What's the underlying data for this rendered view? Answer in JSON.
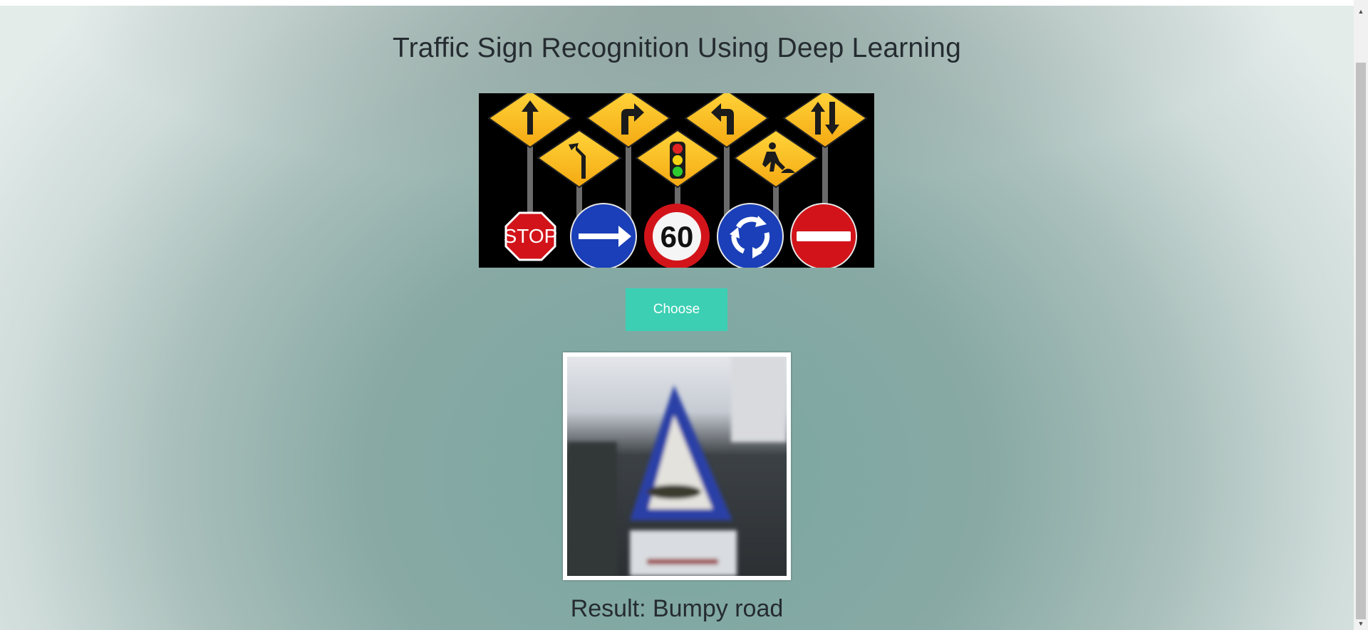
{
  "page": {
    "title": "Traffic Sign Recognition Using Deep Learning",
    "choose_label": "Choose",
    "result_text": "Result: Bumpy road"
  },
  "banner": {
    "icons": [
      "arrow-up-sign-icon",
      "turn-right-sign-icon",
      "turn-left-sign-icon",
      "two-way-traffic-sign-icon",
      "merge-left-sign-icon",
      "traffic-light-sign-icon",
      "road-work-sign-icon",
      "stop-sign-icon",
      "keep-right-sign-icon",
      "speed-limit-sign-icon",
      "roundabout-sign-icon",
      "no-entry-sign-icon"
    ],
    "stop_text": "STOP",
    "speed_text": "60"
  },
  "colors": {
    "accent": "#3ccfb3",
    "warning_yellow": "#f6b81a",
    "sign_blue": "#1a3fb8",
    "sign_red": "#d2141a"
  }
}
